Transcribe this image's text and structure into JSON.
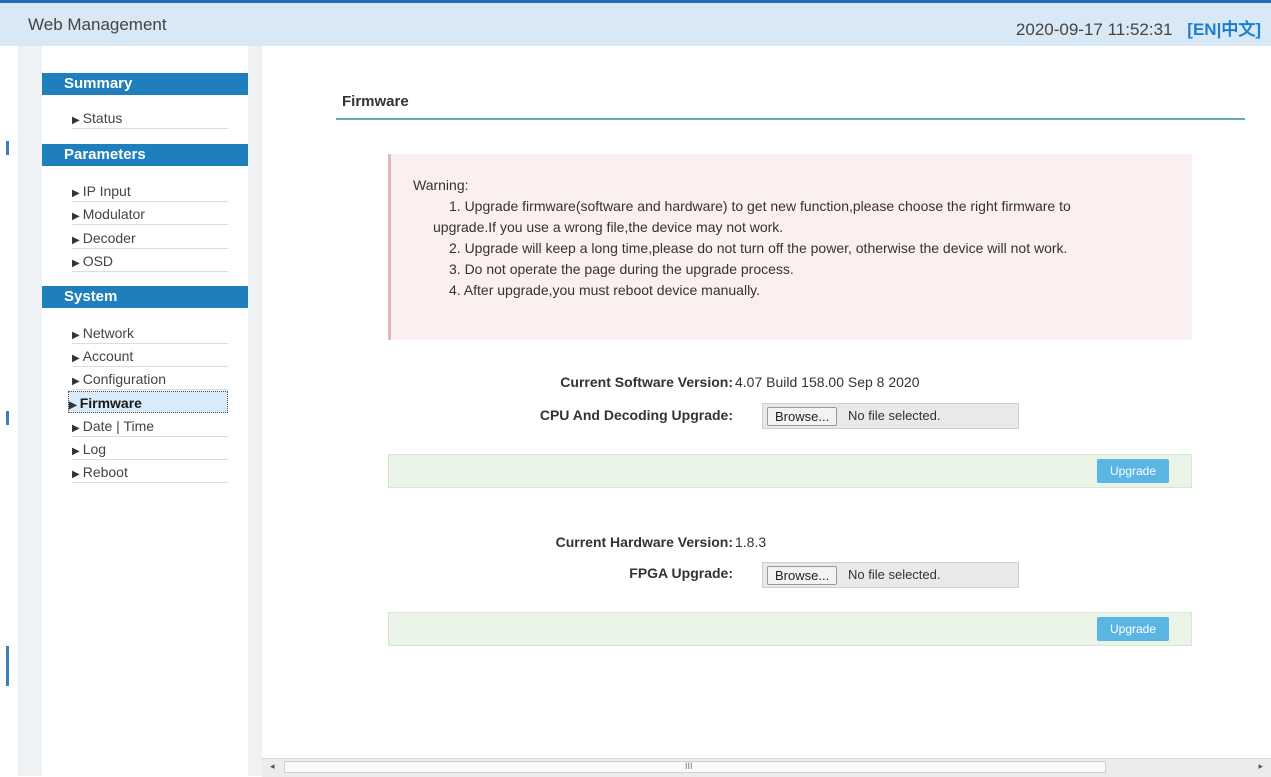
{
  "header": {
    "title": "Web Management",
    "datetime": "2020-09-17 11:52:31",
    "lang_open": "[",
    "lang_en": "EN",
    "lang_sep": "|",
    "lang_zh": "中文",
    "lang_close": "]"
  },
  "sidebar": {
    "sections": [
      {
        "title": "Summary",
        "items": [
          {
            "label": "Status"
          }
        ]
      },
      {
        "title": "Parameters",
        "items": [
          {
            "label": "IP Input"
          },
          {
            "label": "Modulator"
          },
          {
            "label": "Decoder"
          },
          {
            "label": "OSD"
          }
        ]
      },
      {
        "title": "System",
        "items": [
          {
            "label": "Network"
          },
          {
            "label": "Account"
          },
          {
            "label": "Configuration"
          },
          {
            "label": "Firmware"
          },
          {
            "label": "Date | Time"
          },
          {
            "label": "Log"
          },
          {
            "label": "Reboot"
          }
        ]
      }
    ],
    "active_item": "Firmware"
  },
  "main": {
    "title": "Firmware",
    "warning": {
      "heading": "Warning:",
      "line1": "1. Upgrade firmware(software and hardware) to get new function,please choose the right firmware to",
      "line1_cont": "upgrade.If you use a wrong file,the device may not work.",
      "line2": "2. Upgrade will keep a long time,please do not turn off the power, otherwise the device will not work.",
      "line3": "3. Do not operate the page during the upgrade process.",
      "line4": "4. After upgrade,you must reboot device manually."
    },
    "software": {
      "version_label": "Current Software Version:",
      "version_value": "4.07 Build 158.00 Sep 8 2020",
      "upgrade_label": "CPU And Decoding Upgrade:",
      "browse_label": "Browse...",
      "file_status": "No file selected.",
      "upgrade_button": "Upgrade"
    },
    "hardware": {
      "version_label": "Current Hardware Version:",
      "version_value": "1.8.3",
      "upgrade_label": "FPGA Upgrade:",
      "browse_label": "Browse...",
      "file_status": "No file selected.",
      "upgrade_button": "Upgrade"
    }
  },
  "scrollbar": {
    "left_arrow": "◂",
    "right_arrow": "▸",
    "grip": "III"
  },
  "icons": {
    "nav_bullet": "triangle-right-icon"
  },
  "colors": {
    "accent": "#1f7fbd",
    "button": "#5bb5e3",
    "warning_bg": "#fcefef",
    "action_bar_bg": "#eaf3e8"
  }
}
